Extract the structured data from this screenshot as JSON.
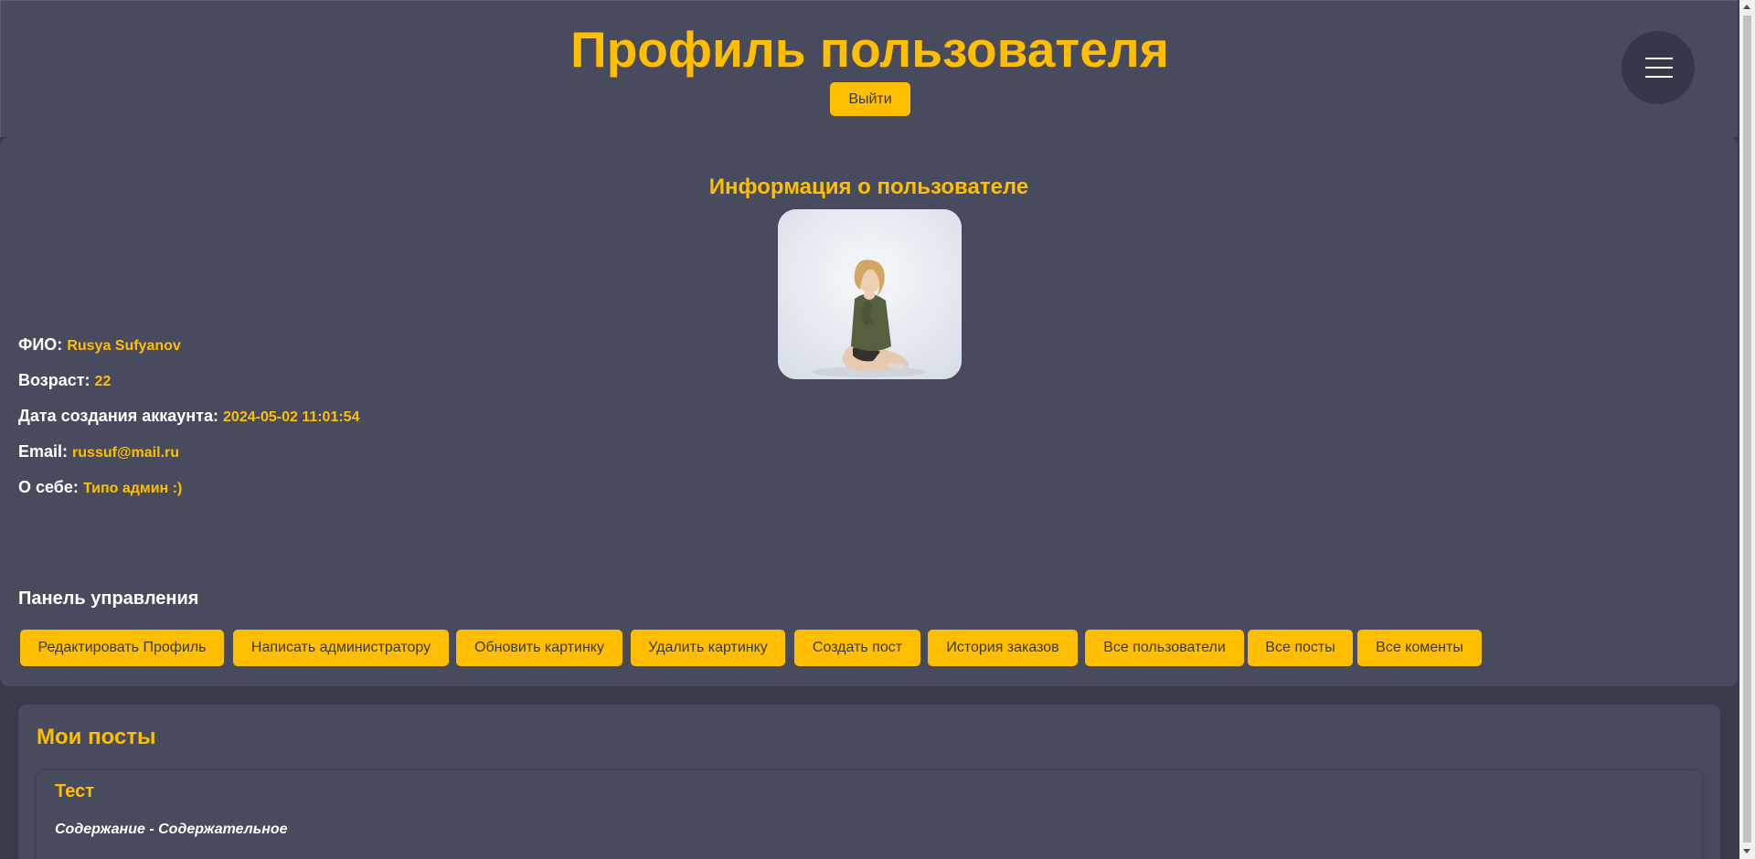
{
  "header": {
    "title": "Профиль пользователя",
    "logout_label": "Выйти",
    "menu_icon": "hamburger-icon"
  },
  "user_info": {
    "section_title": "Информация о пользователе",
    "avatar_alt": "user-photo",
    "fields": [
      {
        "label": "ФИО:",
        "value": "Rusya Sufyanov"
      },
      {
        "label": "Возраст:",
        "value": "22"
      },
      {
        "label": "Дата создания аккаунта:",
        "value": "2024-05-02 11:01:54"
      },
      {
        "label": "Email:",
        "value": "russuf@mail.ru"
      },
      {
        "label": "О себе:",
        "value": "Типо админ :)"
      }
    ],
    "panel_title": "Панель управления",
    "actions": [
      "Редактировать Профиль",
      "Написать администратору",
      "Обновить картинку",
      "Удалить картинку",
      "Создать пост",
      "История заказов",
      "Все пользователи",
      "Все посты",
      "Все коменты"
    ]
  },
  "posts": {
    "title": "Мои посты",
    "items": [
      {
        "title": "Тест",
        "content": "Содержание - Содержательное"
      }
    ]
  },
  "colors": {
    "accent": "#ffbf00",
    "background": "#393b4b",
    "panel": "#474b5d"
  }
}
